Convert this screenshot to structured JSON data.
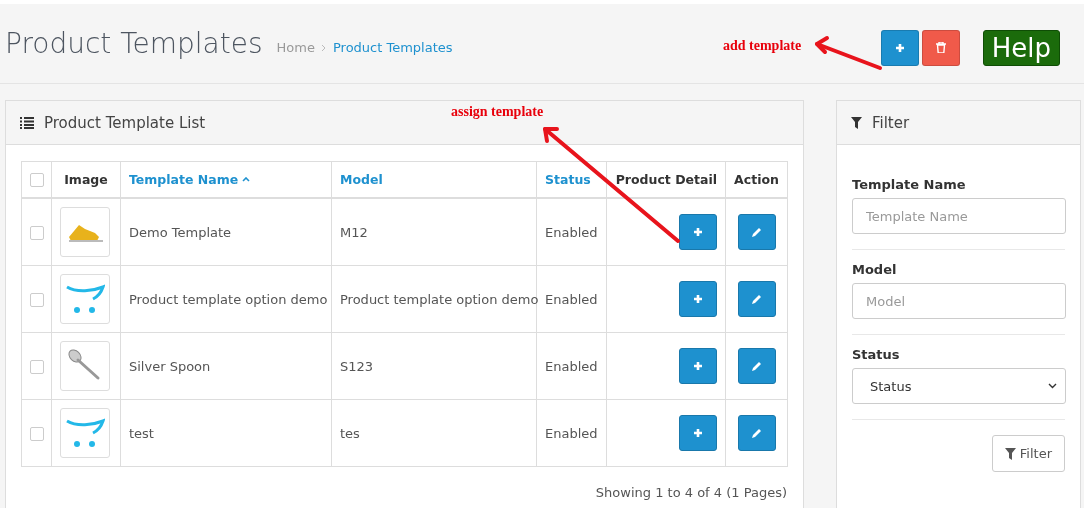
{
  "header": {
    "title": "Product Templates",
    "breadcrumb": [
      {
        "label": "Home",
        "current": false
      },
      {
        "label": "Product Templates",
        "current": true
      }
    ],
    "help": "Help"
  },
  "annotations": [
    {
      "kind": "add",
      "text": "add template"
    },
    {
      "kind": "assign",
      "text": "assign template"
    }
  ],
  "list_panel": {
    "title": "Product Template List",
    "columns": [
      {
        "kind": "check",
        "checked": false
      },
      {
        "label": "Image",
        "kind": "plain"
      },
      {
        "label": "Template Name",
        "kind": "link",
        "sorted": true
      },
      {
        "label": "Model",
        "kind": "link",
        "sorted": false
      },
      {
        "label": "Status",
        "kind": "link",
        "sorted": false
      },
      {
        "label": "Product Detail",
        "kind": "plain"
      },
      {
        "label": "Action",
        "kind": "plain"
      }
    ],
    "rows": [
      {
        "checked": false,
        "kind": "shoe",
        "name": "Demo Template",
        "model": "M12",
        "status": "Enabled"
      },
      {
        "checked": false,
        "kind": "cart",
        "name": "Product template option demo",
        "model": "Product template option demo",
        "status": "Enabled"
      },
      {
        "checked": false,
        "kind": "spoon",
        "name": "Silver Spoon",
        "model": "S123",
        "status": "Enabled"
      },
      {
        "checked": false,
        "kind": "cart",
        "name": "test",
        "model": "tes",
        "status": "Enabled"
      }
    ],
    "pagination": "Showing 1 to 4 of 4 (1 Pages)"
  },
  "filter_panel": {
    "title": "Filter",
    "fields": [
      {
        "kind": "input",
        "label": "Template Name",
        "placeholder": "Template Name"
      },
      {
        "kind": "input",
        "label": "Model",
        "placeholder": "Model"
      },
      {
        "kind": "select",
        "label": "Status",
        "value": "Status"
      }
    ],
    "button": "Filter"
  }
}
